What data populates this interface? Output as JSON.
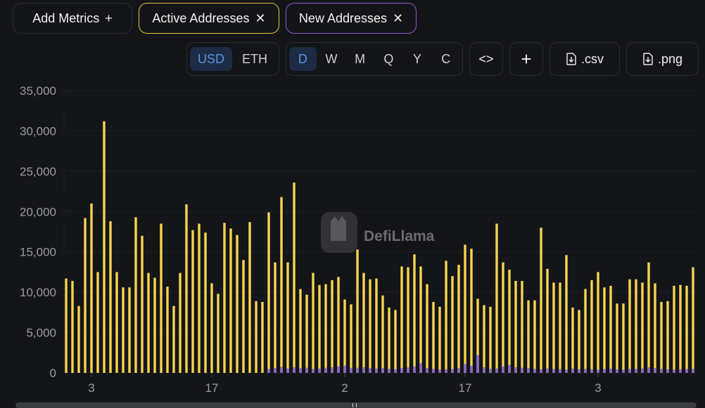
{
  "controls": {
    "add_metrics": "Add Metrics",
    "add_icon": "+",
    "active_chip": "Active Addresses",
    "new_chip": "New Addresses",
    "close_icon": "✕",
    "currency": [
      "USD",
      "ETH"
    ],
    "currency_selected": "USD",
    "periods": [
      "D",
      "W",
      "M",
      "Q",
      "Y",
      "C"
    ],
    "period_selected": "D",
    "embed": "<>",
    "plus": "+",
    "csv": ".csv",
    "png": ".png"
  },
  "watermark": "DefiLlama",
  "colors": {
    "active": "#f5d44e",
    "new": "#8b6bd0",
    "axis_text": "#9a9ca2",
    "grid": "#1e2024",
    "background": "#141518"
  },
  "chart_data": {
    "type": "bar",
    "ylim": [
      0,
      35000
    ],
    "yticks": [
      "35,000",
      "30,000",
      "25,000",
      "20,000",
      "15,000",
      "10,000",
      "5,000",
      "0"
    ],
    "ytick_values": [
      35000,
      30000,
      25000,
      20000,
      15000,
      10000,
      5000,
      0
    ],
    "xticks": [
      {
        "label": "3",
        "index": 4
      },
      {
        "label": "17",
        "index": 23
      },
      {
        "label": "2",
        "index": 44
      },
      {
        "label": "17",
        "index": 63
      },
      {
        "label": "3",
        "index": 84
      },
      {
        "label": "17",
        "index": 102
      },
      {
        "label": "2",
        "index": 122
      }
    ],
    "series": [
      {
        "name": "Active Addresses",
        "color": "#f5d44e",
        "values": [
          11700,
          11400,
          8300,
          19200,
          21000,
          12500,
          31200,
          18800,
          12500,
          10600,
          10600,
          19300,
          17000,
          12400,
          11800,
          18500,
          10700,
          8300,
          12400,
          20900,
          17700,
          18500,
          17400,
          11100,
          9800,
          18600,
          17900,
          17100,
          14000,
          18700,
          8900,
          8800,
          19900,
          13700,
          21800,
          13700,
          23600,
          10400,
          9700,
          12400,
          10900,
          11000,
          11500,
          11900,
          9100,
          8500,
          15300,
          12400,
          11600,
          11700,
          9600,
          8100,
          7800,
          13200,
          13100,
          14700,
          13200,
          11000,
          8800,
          8200,
          13900,
          12000,
          13400,
          15900,
          15400,
          9200,
          8400,
          8200,
          18500,
          13700,
          12800,
          11400,
          11400,
          9000,
          9000,
          18000,
          12900,
          11200,
          11200,
          14600,
          8100,
          7800,
          10400,
          11500,
          12500,
          10600,
          10800,
          8600,
          8600,
          11600,
          11600,
          11200,
          13700,
          11100,
          8800,
          8900,
          10800,
          10900,
          10800,
          13100
        ]
      },
      {
        "name": "New Addresses",
        "color": "#8b6bd0",
        "values": [
          0,
          0,
          0,
          0,
          0,
          0,
          0,
          0,
          0,
          0,
          0,
          0,
          0,
          0,
          0,
          0,
          0,
          0,
          0,
          0,
          0,
          0,
          0,
          0,
          0,
          0,
          0,
          0,
          0,
          0,
          0,
          0,
          500,
          600,
          750,
          550,
          700,
          600,
          650,
          500,
          550,
          650,
          700,
          800,
          900,
          600,
          650,
          700,
          600,
          550,
          600,
          500,
          450,
          600,
          700,
          800,
          1200,
          600,
          500,
          400,
          450,
          500,
          600,
          1100,
          900,
          2200,
          700,
          500,
          550,
          800,
          1000,
          700,
          650,
          600,
          500,
          450,
          550,
          500,
          450,
          400,
          550,
          450,
          500,
          450,
          400,
          500,
          550,
          450,
          400,
          500,
          500,
          550,
          700,
          600,
          500,
          450,
          400,
          450,
          500,
          500
        ]
      }
    ]
  }
}
